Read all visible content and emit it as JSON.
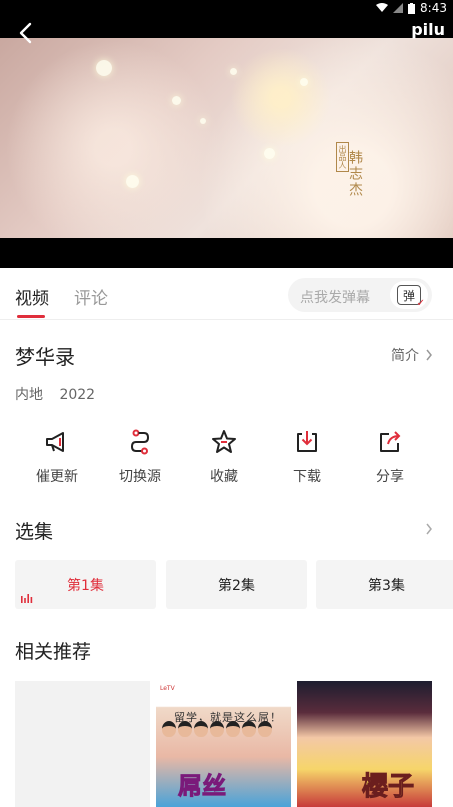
{
  "status_bar": {
    "time": "8:43"
  },
  "video": {
    "watermark": "pilu",
    "credit_stamp": "出品人",
    "credit_name": "韩志杰"
  },
  "tabs": [
    {
      "label": "视频",
      "active": true
    },
    {
      "label": "评论",
      "active": false
    }
  ],
  "danmu": {
    "placeholder": "点我发弹幕",
    "button_label": "弹"
  },
  "show": {
    "title": "梦华录",
    "intro_label": "简介",
    "region": "内地",
    "year": "2022"
  },
  "actions": [
    {
      "label": "催更新",
      "icon": "megaphone-icon"
    },
    {
      "label": "切换源",
      "icon": "switch-source-icon"
    },
    {
      "label": "收藏",
      "icon": "star-icon"
    },
    {
      "label": "下载",
      "icon": "download-icon"
    },
    {
      "label": "分享",
      "icon": "share-icon"
    }
  ],
  "episodes_section": {
    "title": "选集",
    "episodes": [
      {
        "label": "第1集",
        "active": true
      },
      {
        "label": "第2集",
        "active": false
      },
      {
        "label": "第3集",
        "active": false
      }
    ]
  },
  "recommend_section": {
    "title": "相关推荐",
    "items": [
      {
        "poster_top": "",
        "poster_sub": "",
        "poster_big": ""
      },
      {
        "poster_top": "LeTV",
        "poster_sub": "留学，就是这么屌！",
        "poster_big": "屌丝"
      },
      {
        "poster_top": "",
        "poster_sub": "",
        "poster_big": "樱子"
      }
    ]
  },
  "colors": {
    "accent": "#e02e3b",
    "text": "#222222",
    "muted": "#999999"
  }
}
